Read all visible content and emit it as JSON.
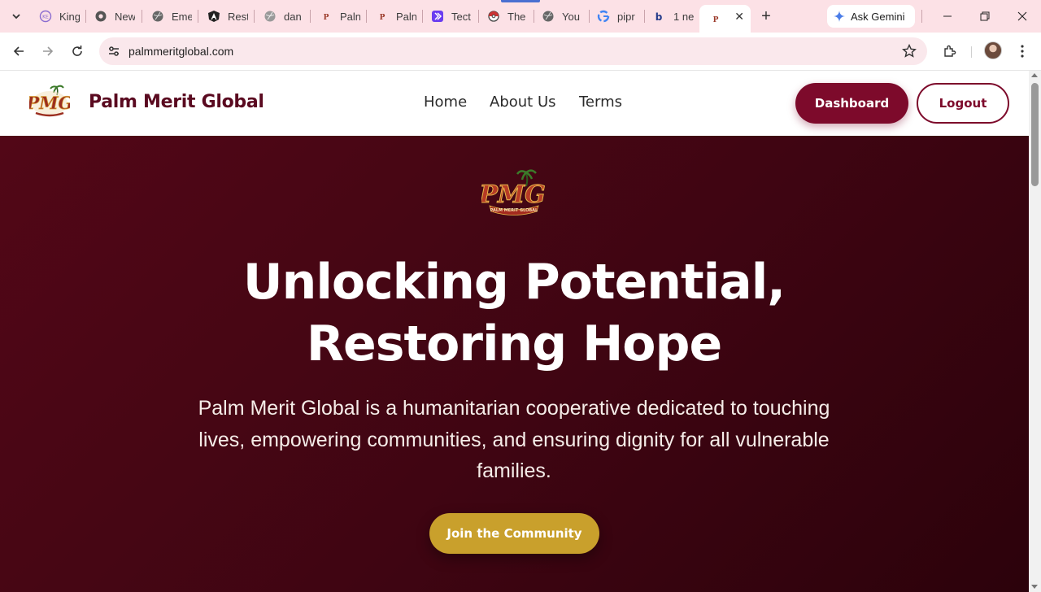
{
  "browser": {
    "tabs": [
      {
        "label": "King",
        "icon": "kingdom-icon"
      },
      {
        "label": "New",
        "icon": "shield-icon"
      },
      {
        "label": "Eme",
        "icon": "globe-icon"
      },
      {
        "label": "Rest",
        "icon": "angular-icon"
      },
      {
        "label": "dan",
        "icon": "globe-icon"
      },
      {
        "label": "Paln",
        "icon": "pmg-icon"
      },
      {
        "label": "Paln",
        "icon": "pmg-icon"
      },
      {
        "label": "Tect",
        "icon": "chevron-app-icon"
      },
      {
        "label": "The",
        "icon": "pokeball-icon"
      },
      {
        "label": "You",
        "icon": "globe-icon"
      },
      {
        "label": "pipr",
        "icon": "google-icon"
      },
      {
        "label": "1 ne",
        "icon": "bold-b-icon"
      }
    ],
    "active_tab_icon": "pmg-icon",
    "ask_gemini": "Ask Gemini",
    "url": "palmmeritglobal.com"
  },
  "site": {
    "brand": "Palm Merit Global",
    "nav": [
      "Home",
      "About Us",
      "Terms"
    ],
    "dashboard_label": "Dashboard",
    "logout_label": "Logout",
    "logo_text": "PMG",
    "logo_caption": "PALM MERIT GLOBAL"
  },
  "hero": {
    "title_line1": "Unlocking Potential,",
    "title_line2": "Restoring Hope",
    "subtitle": "Palm Merit Global is a humanitarian cooperative dedicated to touching lives, empowering communities, and ensuring dignity for all vulnerable families.",
    "cta_label": "Join the Community"
  },
  "colors": {
    "brand_maroon": "#7d0a2b",
    "hero_bg": "#4a0614",
    "gold": "#c9a02c",
    "tabstrip": "#fce1e6"
  }
}
